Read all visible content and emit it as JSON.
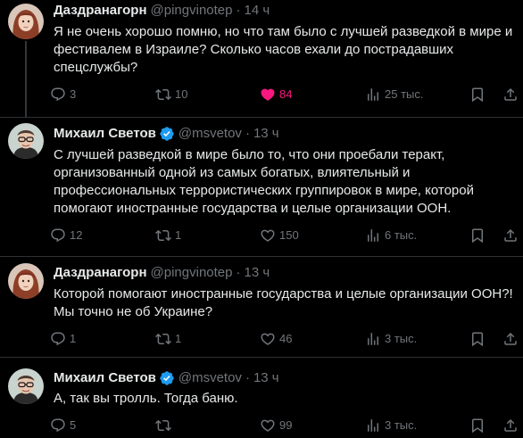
{
  "tweets": [
    {
      "name": "Даздранагорн",
      "handle": "@pingvinotep",
      "sep": "·",
      "time": "14 ч",
      "verified": false,
      "lines": [
        "Я не очень хорошо помню, но что там было с лучшей разведкой в мире и",
        "фестивалем в Израиле? Сколько часов ехали до пострадавших",
        "спецслужбы?"
      ],
      "replies": "3",
      "reposts": "10",
      "likes": "84",
      "liked": true,
      "views": "25 тыс."
    },
    {
      "name": "Михаил Светов",
      "handle": "@msvetov",
      "sep": "·",
      "time": "13 ч",
      "verified": true,
      "lines": [
        "С лучшей разведкой в мире было то, что они проебали теракт,",
        "организованный одной из самых богатых, влиятельный и",
        "профессиональных террористических группировок в мире, которой",
        "помогают иностранные государства и целые организации ООН."
      ],
      "replies": "12",
      "reposts": "1",
      "likes": "150",
      "liked": false,
      "views": "6 тыс."
    },
    {
      "name": "Даздранагорн",
      "handle": "@pingvinotep",
      "sep": "·",
      "time": "13 ч",
      "verified": false,
      "lines": [
        "Которой помогают иностранные государства и целые организации ООН?!",
        "Мы точно не об Украине?"
      ],
      "replies": "1",
      "reposts": "1",
      "likes": "46",
      "liked": false,
      "views": "3 тыс."
    },
    {
      "name": "Михаил Светов",
      "handle": "@msvetov",
      "sep": "·",
      "time": "13 ч",
      "verified": true,
      "lines": [
        "А, так вы тролль. Тогда баню."
      ],
      "replies": "5",
      "reposts": "",
      "likes": "99",
      "liked": false,
      "views": "3 тыс."
    }
  ],
  "colors": {
    "background": "#000000",
    "text": "#e7e9ea",
    "muted": "#71767b",
    "like": "#f91880",
    "verified": "#1d9bf0",
    "divider": "#2f3336"
  },
  "icons": [
    "reply-icon",
    "repost-icon",
    "like-icon",
    "views-icon",
    "bookmark-icon",
    "share-icon",
    "verified-badge-icon"
  ]
}
